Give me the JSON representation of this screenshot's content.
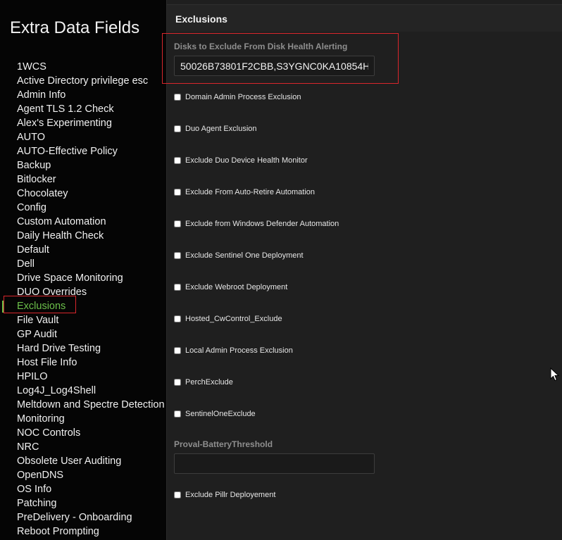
{
  "sidebar": {
    "title": "Extra Data Fields",
    "items": [
      {
        "label": "1WCS"
      },
      {
        "label": "Active Directory privilege esc"
      },
      {
        "label": "Admin Info"
      },
      {
        "label": "Agent TLS 1.2 Check"
      },
      {
        "label": "Alex's Experimenting"
      },
      {
        "label": "AUTO"
      },
      {
        "label": "AUTO-Effective Policy"
      },
      {
        "label": "Backup"
      },
      {
        "label": "Bitlocker"
      },
      {
        "label": "Chocolatey"
      },
      {
        "label": "Config"
      },
      {
        "label": "Custom Automation"
      },
      {
        "label": "Daily Health Check"
      },
      {
        "label": "Default"
      },
      {
        "label": "Dell"
      },
      {
        "label": "Drive Space Monitoring"
      },
      {
        "label": "DUO Overrides"
      },
      {
        "label": "Exclusions",
        "active": true
      },
      {
        "label": "File Vault"
      },
      {
        "label": "GP Audit"
      },
      {
        "label": "Hard Drive Testing"
      },
      {
        "label": "Host File Info"
      },
      {
        "label": "HPILO"
      },
      {
        "label": "Log4J_Log4Shell"
      },
      {
        "label": "Meltdown and Spectre Detection"
      },
      {
        "label": "Monitoring"
      },
      {
        "label": "NOC Controls"
      },
      {
        "label": "NRC"
      },
      {
        "label": "Obsolete User Auditing"
      },
      {
        "label": "OpenDNS"
      },
      {
        "label": "OS Info"
      },
      {
        "label": "Patching"
      },
      {
        "label": "PreDelivery - Onboarding"
      },
      {
        "label": "Reboot Prompting"
      }
    ]
  },
  "main": {
    "title": "Exclusions",
    "disk_field": {
      "label": "Disks to Exclude From Disk Health Alerting",
      "value": "50026B73801F2CBB,S3YGNC0KA10854H"
    },
    "checkboxes": [
      {
        "label": "Domain Admin Process Exclusion",
        "checked": false
      },
      {
        "label": "Duo Agent Exclusion",
        "checked": false
      },
      {
        "label": "Exclude Duo Device Health Monitor",
        "checked": false
      },
      {
        "label": "Exclude From Auto-Retire Automation",
        "checked": false
      },
      {
        "label": "Exclude from Windows Defender Automation",
        "checked": false
      },
      {
        "label": "Exclude Sentinel One Deployment",
        "checked": false
      },
      {
        "label": "Exclude Webroot Deployment",
        "checked": false
      },
      {
        "label": "Hosted_CwControl_Exclude",
        "checked": false
      },
      {
        "label": "Local Admin Process Exclusion",
        "checked": false
      },
      {
        "label": "PerchExclude",
        "checked": false
      },
      {
        "label": "SentinelOneExclude",
        "checked": false
      }
    ],
    "battery_field": {
      "label": "Proval-BatteryThreshold",
      "value": ""
    },
    "last_checkbox": {
      "label": "Exclude Pillr Deployement",
      "checked": false
    }
  },
  "colors": {
    "accent": "#6cc04a",
    "highlight": "#d9262c",
    "sidebar_bg": "#050505",
    "main_bg": "#1f1f1f"
  }
}
